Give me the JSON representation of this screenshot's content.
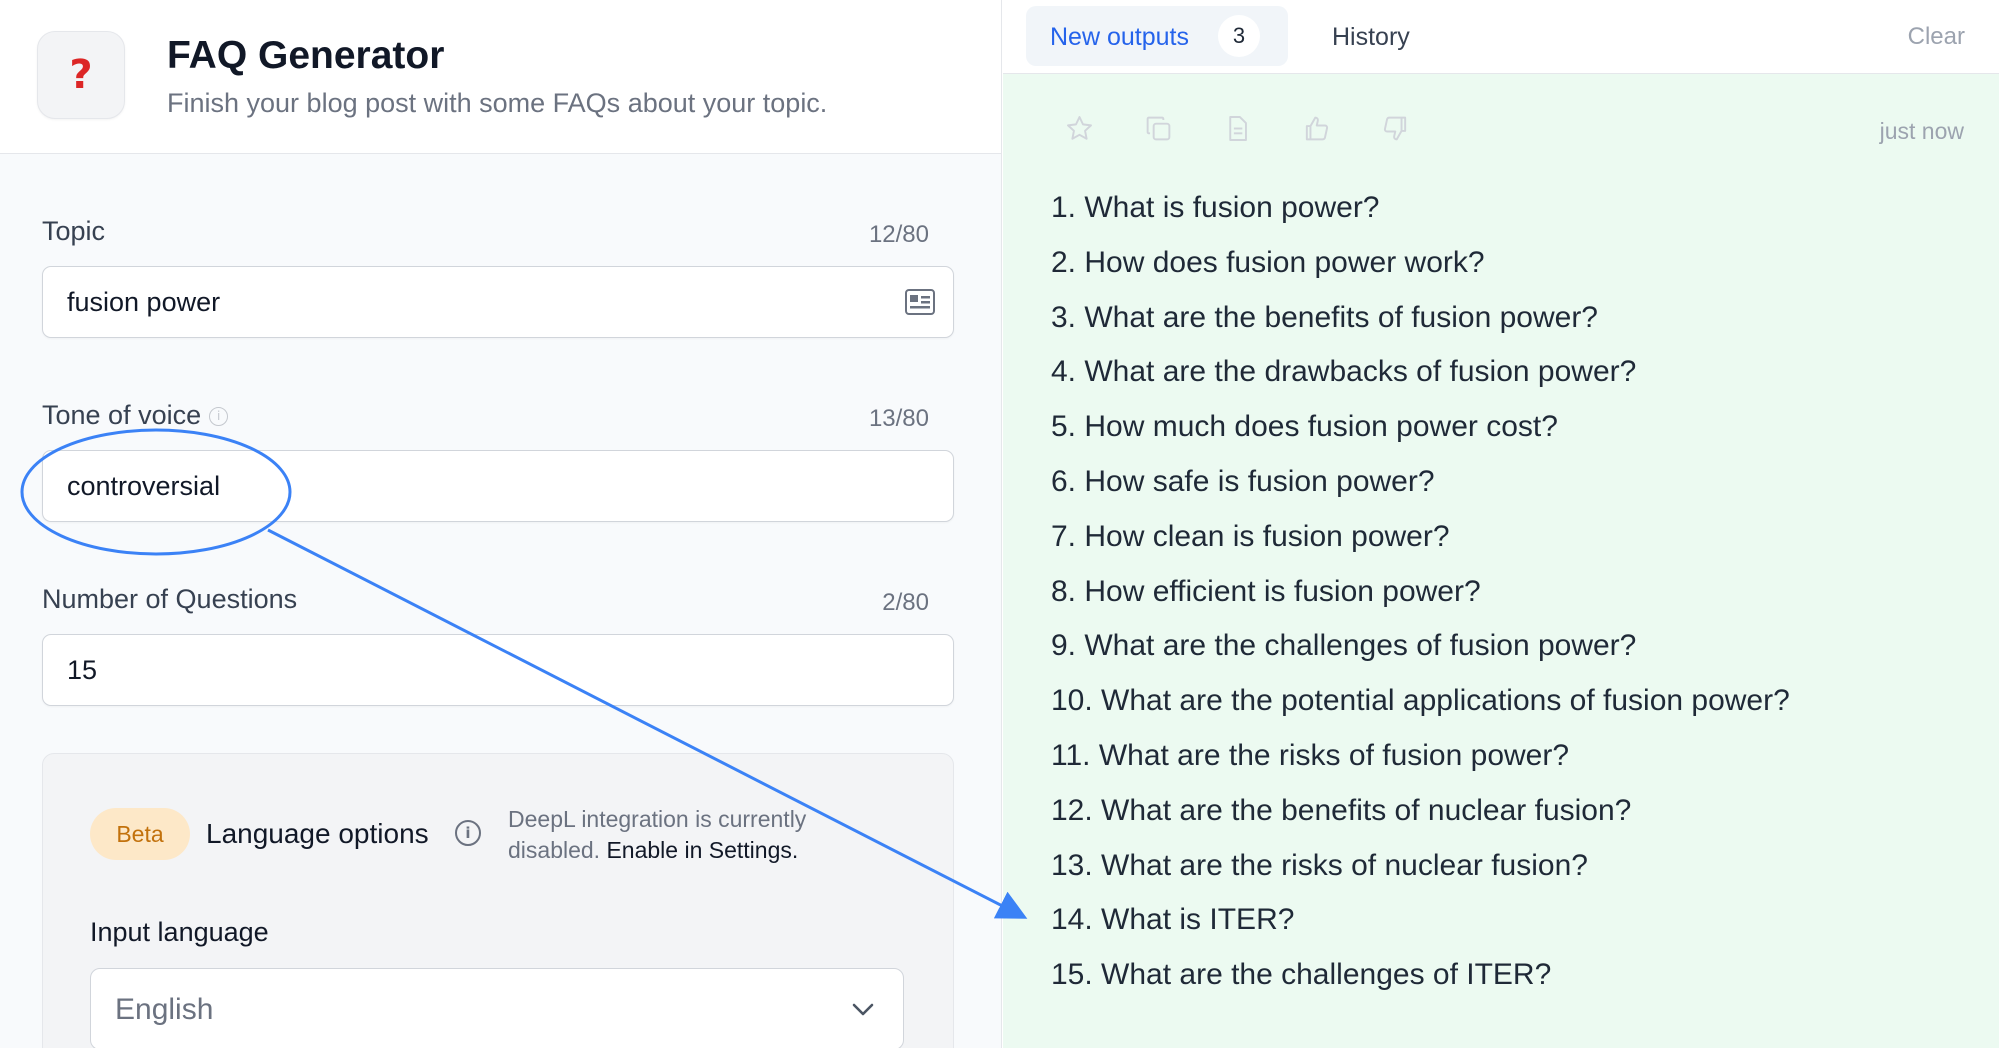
{
  "app": {
    "icon_glyph": "?",
    "title": "FAQ Generator",
    "subtitle": "Finish your blog post with some FAQs about your topic."
  },
  "form": {
    "topic": {
      "label": "Topic",
      "count": "12/80",
      "value": "fusion power"
    },
    "tone": {
      "label": "Tone of voice",
      "count": "13/80",
      "value": "controversial"
    },
    "questions": {
      "label": "Number of Questions",
      "count": "2/80",
      "value": "15"
    }
  },
  "language": {
    "badge": "Beta",
    "title": "Language options",
    "note": "DeepL integration is currently disabled.",
    "link": "Enable in Settings.",
    "input_label": "Input language",
    "input_value": "English"
  },
  "outputs": {
    "tab_new_label": "New outputs",
    "tab_new_count": "3",
    "tab_history_label": "History",
    "clear_label": "Clear",
    "timestamp": "just now",
    "items": [
      "1. What is fusion power?",
      "2. How does fusion power work?",
      "3. What are the benefits of fusion power?",
      "4. What are the drawbacks of fusion power?",
      "5. How much does fusion power cost?",
      "6. How safe is fusion power?",
      "7. How clean is fusion power?",
      "8. How efficient is fusion power?",
      "9. What are the challenges of fusion power?",
      "10. What are the potential applications of fusion power?",
      "11. What are the risks of fusion power?",
      "12. What are the benefits of nuclear fusion?",
      "13. What are the risks of nuclear fusion?",
      "14. What is ITER?",
      "15. What are the challenges of ITER?"
    ]
  },
  "colors": {
    "accent": "#2563eb",
    "annotation": "#3b82f6",
    "output_bg": "#ecfaf1",
    "icon_red": "#dc2626",
    "beta_bg": "#fde8c8"
  }
}
